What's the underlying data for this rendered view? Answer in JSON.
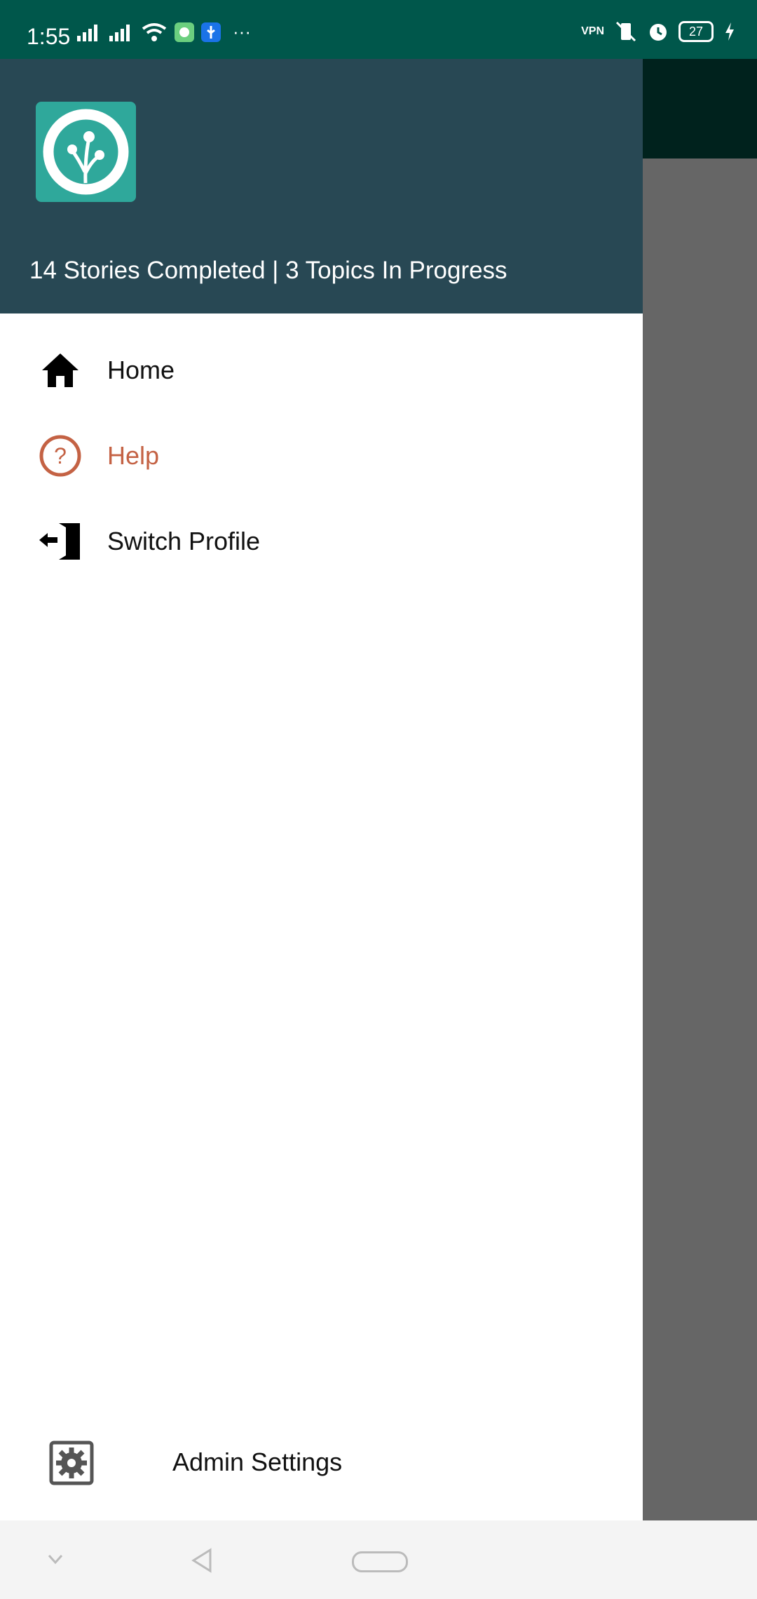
{
  "status_bar": {
    "time": "1:55",
    "battery": "27",
    "icons_left": [
      "signal-icon",
      "signal-icon",
      "wifi-icon",
      "app-notification-icon",
      "usb-icon",
      "more-icon"
    ],
    "icons_right": [
      "vpn-icon",
      "vibrate-icon",
      "alarm-icon",
      "battery-icon",
      "charging-icon"
    ]
  },
  "drawer": {
    "header_text": "14 Stories Completed | 3 Topics In Progress",
    "items": [
      {
        "label": "Home",
        "icon": "home-icon"
      },
      {
        "label": "Help",
        "icon": "help-icon",
        "selected": true
      },
      {
        "label": "Switch Profile",
        "icon": "switch-profile-icon"
      }
    ],
    "admin": {
      "label": "Admin Settings",
      "icon": "gear-icon"
    }
  },
  "colors": {
    "status_bar": "#00574B",
    "drawer_header": "#284854",
    "avatar_bg": "#2FA89B",
    "selected_item": "#C46244"
  }
}
